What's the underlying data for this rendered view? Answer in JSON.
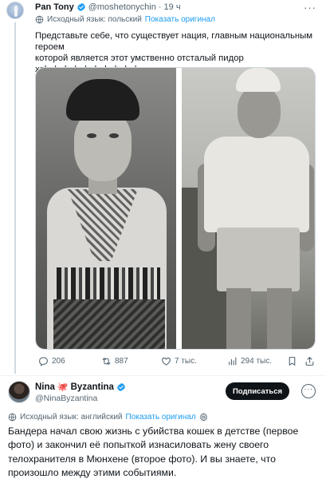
{
  "tweet1": {
    "author_name": "Pan Tony",
    "author_handle": "@moshetonychin",
    "time": "19 ч",
    "more_label": "···",
    "translation_note": "Исходный язык: польский",
    "show_original": "Показать оригинал",
    "text_lines": [
      "Представьте себе, что существует нация, главным национальным героем",
      "которой является этот умственно отсталый пидор",
      "хаhahahahahahahahahaha"
    ],
    "stats": {
      "replies": "206",
      "retweets": "887",
      "likes": "7 тыс.",
      "views": "294 тыс."
    }
  },
  "tweet2": {
    "author_name": "Nina",
    "emoji": "🐙",
    "author_name_2": "Byzantina",
    "author_handle": "@NinaByzantina",
    "subscribe_label": "Подписаться",
    "more_label": "···",
    "translation_note": "Исходный язык: английский",
    "show_original": "Показать оригинал",
    "text": "Бандера начал свою жизнь с убийства кошек в детстве (первое фото) и закончил её попыткой изнасиловать жену своего телохранителя в Мюнхене (второе фото). И вы знаете, что произошло между этими событиями."
  },
  "colors": {
    "verified_blue": "#1d9bf0",
    "link_blue": "#1d9bf0",
    "secondary_text": "#536471",
    "button_black": "#0f1419"
  }
}
